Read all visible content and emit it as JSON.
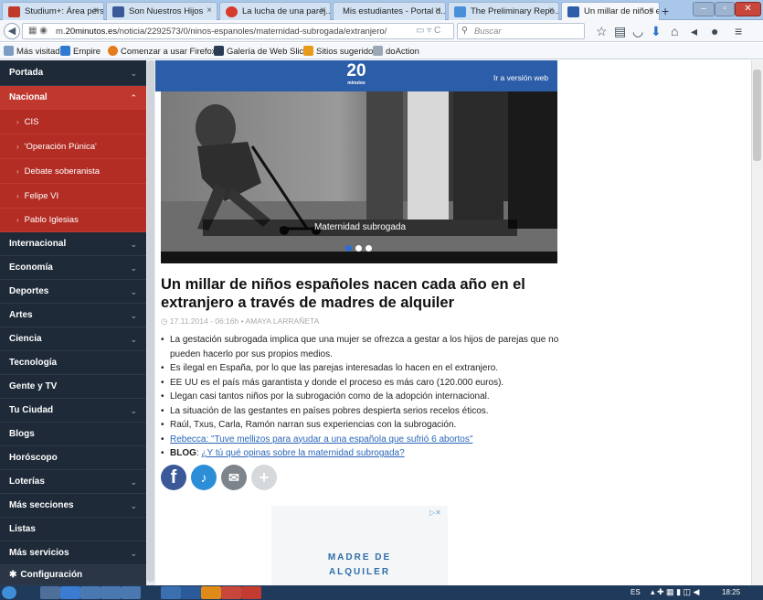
{
  "browser": {
    "tabs": [
      {
        "label": "Studium+: Área pers...",
        "color": "#c0392b"
      },
      {
        "label": "Son Nuestros Hijos",
        "color": "#3b5998"
      },
      {
        "label": "La lucha de una parej...",
        "color": "#d63a2c"
      },
      {
        "label": "Mis estudiantes - Portal d...",
        "color": "#7a8a9b"
      },
      {
        "label": "The Preliminary Repo...",
        "color": "#4a90d9"
      },
      {
        "label": "Un millar de niños es...",
        "color": "#2c5da8"
      }
    ],
    "url_prefix": "m.",
    "url_domain": "20minutos.es",
    "url_path": "/noticia/2292573/0/ninos-espanoles/maternidad-subrogada/extranjero/",
    "search_placeholder": "Buscar",
    "bookmarks": [
      "Más visitados",
      "Empire",
      "Comenzar a usar Firefox",
      "Galería de Web Slice",
      "Sitios sugeridos",
      "doAction"
    ]
  },
  "sidebar": {
    "items": [
      {
        "label": "Portada",
        "chevron": "⌄"
      },
      {
        "label": "Nacional",
        "chevron": "⌃"
      },
      {
        "label": "Internacional",
        "chevron": "⌄"
      },
      {
        "label": "Economía",
        "chevron": "⌄"
      },
      {
        "label": "Deportes",
        "chevron": "⌄"
      },
      {
        "label": "Artes",
        "chevron": "⌄"
      },
      {
        "label": "Ciencia",
        "chevron": "⌄"
      },
      {
        "label": "Tecnología",
        "chevron": ""
      },
      {
        "label": "Gente y TV",
        "chevron": ""
      },
      {
        "label": "Tu Ciudad",
        "chevron": "⌄"
      },
      {
        "label": "Blogs",
        "chevron": ""
      },
      {
        "label": "Horóscopo",
        "chevron": ""
      },
      {
        "label": "Loterías",
        "chevron": "⌄"
      },
      {
        "label": "Más secciones",
        "chevron": "⌄"
      },
      {
        "label": "Listas",
        "chevron": ""
      },
      {
        "label": "Más servicios",
        "chevron": "⌄"
      },
      {
        "label": "Configuración",
        "chevron": ""
      }
    ],
    "subitems": [
      "CIS",
      "'Operación Púnica'",
      "Debate soberanista",
      "Felipe VI",
      "Pablo Iglesias"
    ]
  },
  "header": {
    "logo_number": "20",
    "logo_word": "minutos",
    "goto_web": "Ir a versión web"
  },
  "article": {
    "image_caption": "Maternidad subrogada",
    "headline": "Un millar de niños españoles nacen cada año en el extranjero a través de madres de alquiler",
    "byline": "17.11.2014 - 06:16h • AMAYA LARRAÑETA",
    "bullets": [
      "La gestación subrogada implica que una mujer se ofrezca a gestar a los hijos de parejas que no pueden hacerlo por sus propios medios.",
      "Es ilegal en España, por lo que las parejas interesadas lo hacen en el extranjero.",
      "EE UU es el país más garantista y donde el proceso es más caro (120.000 euros).",
      "Llegan casi tantos niños por la subrogación como de la adopción internacional.",
      "La situación de las gestantes en países pobres despierta serios recelos éticos.",
      "Raúl, Txus, Carla, Ramón narran sus experiencias con la subrogación."
    ],
    "link_rebecca": "Rebecca: \"Tuve mellizos para ayudar a una española que sufrió 6 abortos\"",
    "blog_label": "BLOG",
    "blog_link": "¿Y tú qué opinas sobre la maternidad subrogada?"
  },
  "ad": {
    "line1": "MADRE DE",
    "line2": "ALQUILER",
    "choice": "▷✕"
  },
  "taskbar": {
    "lang": "ES",
    "time": "18:25"
  }
}
